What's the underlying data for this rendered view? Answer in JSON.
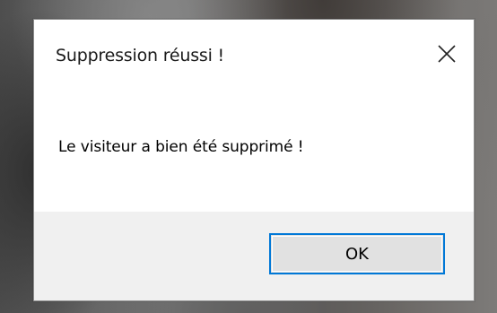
{
  "dialog": {
    "title": "Suppression réussi !",
    "message": "Le visiteur a bien été supprimé !",
    "ok_label": "OK",
    "close_icon": "close-icon"
  },
  "colors": {
    "button_focus_border": "#0078d7",
    "button_background": "#e1e1e1",
    "footer_background": "#f0f0f0",
    "dialog_background": "#ffffff"
  }
}
